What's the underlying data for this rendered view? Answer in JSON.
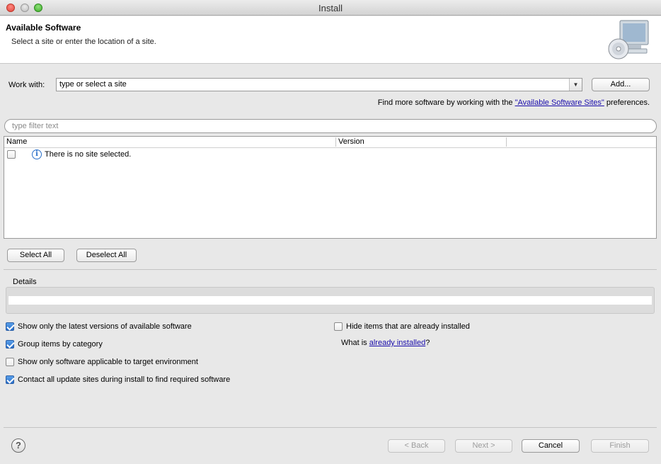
{
  "window": {
    "title": "Install"
  },
  "header": {
    "title": "Available Software",
    "subtitle": "Select a site or enter the location of a site."
  },
  "work_with": {
    "label": "Work with:",
    "value": "type or select a site",
    "add_label": "Add..."
  },
  "find_more": {
    "prefix": "Find more software by working with the ",
    "link": "\"Available Software Sites\"",
    "suffix": " preferences."
  },
  "filter": {
    "placeholder": "type filter text"
  },
  "table": {
    "columns": [
      "Name",
      "Version"
    ],
    "rows": [
      {
        "checked": false,
        "icon": "info-icon",
        "text": "There is no site selected."
      }
    ]
  },
  "selection": {
    "select_all": "Select All",
    "deselect_all": "Deselect All"
  },
  "details": {
    "label": "Details"
  },
  "options": [
    {
      "label": "Show only the latest versions of available software",
      "checked": true
    },
    {
      "label": "Group items by category",
      "checked": true
    },
    {
      "label": "Show only software applicable to target environment",
      "checked": false
    },
    {
      "label": "Contact all update sites during install to find required software",
      "checked": true
    },
    {
      "label": "Hide items that are already installed",
      "checked": false
    }
  ],
  "what_installed": {
    "prefix": "What is ",
    "link": "already installed",
    "suffix": "?"
  },
  "footer": {
    "back": "< Back",
    "next": "Next >",
    "cancel": "Cancel",
    "finish": "Finish",
    "help_glyph": "?"
  }
}
